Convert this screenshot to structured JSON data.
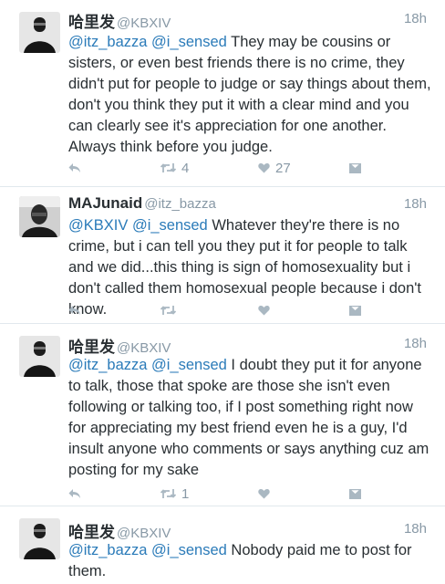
{
  "colors": {
    "mention": "#2b7bb9",
    "meta": "#8899a6",
    "icon": "#aab8c2",
    "divider": "#e1e8ed"
  },
  "tweets": [
    {
      "name": "哈里发",
      "handle": "@KBXIV",
      "time": "18h",
      "mentions": "@itz_bazza @i_sensed",
      "body": " They may be cousins or sisters, or even best friends there is no crime, they didn't put for people to judge or say things about them, don't you think they put it with a clear mind and you can clearly see it's appreciation for one another. Always think before you judge.",
      "retweets": "4",
      "likes": "27"
    },
    {
      "name": "MAJunaid",
      "handle": "@itz_bazza",
      "time": "18h",
      "mentions": "@KBXIV @i_sensed",
      "body": " Whatever they're there is no crime, but i can tell you they put it for people to talk and we did...this thing is sign of homosexuality but i don't called them homosexual people because i don't know.",
      "retweets": "",
      "likes": ""
    },
    {
      "name": "哈里发",
      "handle": "@KBXIV",
      "time": "18h",
      "mentions": "@itz_bazza @i_sensed",
      "body": " I doubt they put it for anyone to talk, those that spoke are those she isn't even following or talking too, if I post something right now for appreciating my best friend even he is a guy, I'd insult anyone who comments or says anything cuz am posting for my sake",
      "retweets": "1",
      "likes": ""
    },
    {
      "name": "哈里发",
      "handle": "@KBXIV",
      "time": "18h",
      "mentions": "@itz_bazza @i_sensed",
      "body": " Nobody paid me to post for them.",
      "retweets": "",
      "likes": ""
    }
  ]
}
